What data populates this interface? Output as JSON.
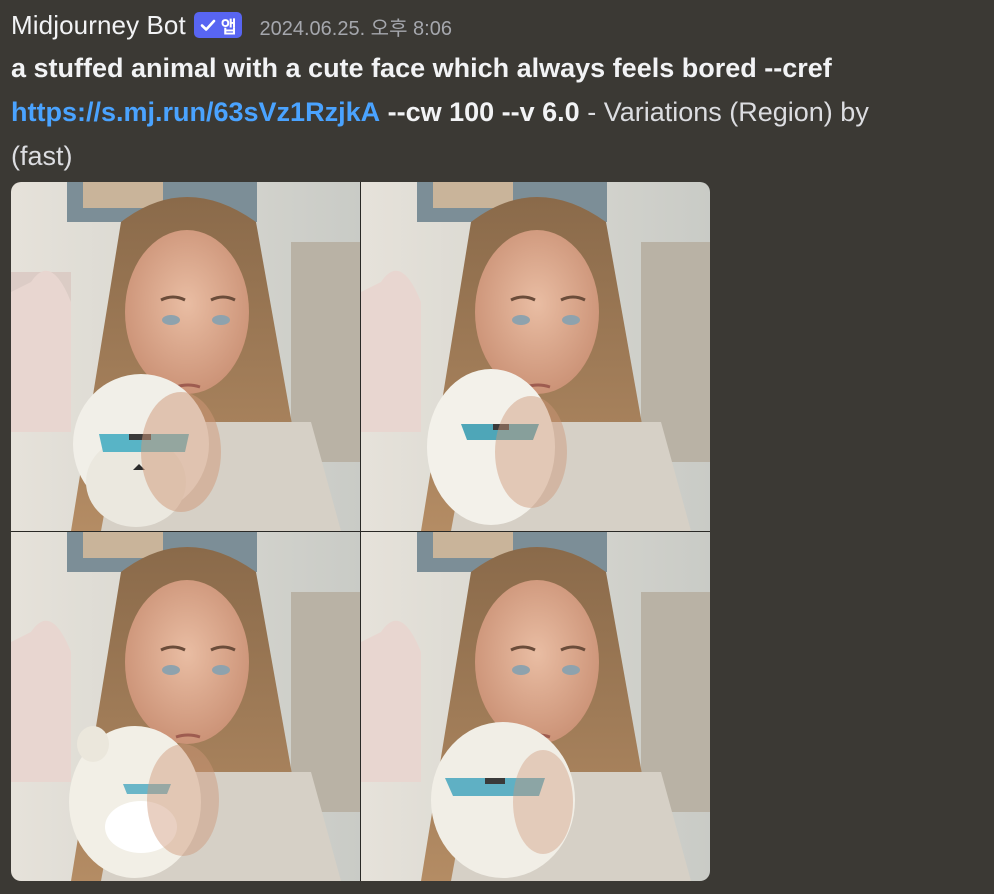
{
  "message": {
    "author": "Midjourney Bot",
    "badge": {
      "icon": "checkmark-icon",
      "label": "앱",
      "color": "#5865f2"
    },
    "timestamp": "2024.06.25. 오후 8:06",
    "prompt": "a stuffed animal with a cute face which always feels bored --cref",
    "link": "https://s.mj.run/63sVz1RzjkA",
    "params": "--cw 100 --v 6.0",
    "suffix": " - Variations (Region) by",
    "mode": "(fast)",
    "link_color": "#4aa3ff",
    "background_color": "#3b3934"
  },
  "images": [
    {
      "name": "variation-1",
      "plush": "cat-plush",
      "glasses_color": "#58b4c6"
    },
    {
      "name": "variation-2",
      "plush": "yeti-plush",
      "glasses_color": "#4ea6b8"
    },
    {
      "name": "variation-3",
      "plush": "seal-plush",
      "glasses_color": "#6ab6c8"
    },
    {
      "name": "variation-4",
      "plush": "fluffy-plush",
      "glasses_color": "#5fb0c4"
    }
  ]
}
